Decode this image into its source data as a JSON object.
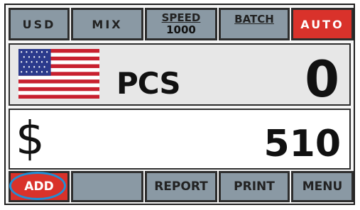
{
  "top_bar": {
    "currency": "USD",
    "mode": "MIX",
    "speed_label": "SPEED",
    "speed_value": "1000",
    "batch_label": "BATCH",
    "auto_label": "AUTO"
  },
  "pcs_panel": {
    "flag_icon": "us-flag-icon",
    "label": "PCS",
    "count": "0"
  },
  "amount_panel": {
    "symbol": "$",
    "amount": "510"
  },
  "bottom_bar": {
    "add_label": "ADD",
    "report_label": "REPORT",
    "print_label": "PRINT",
    "menu_label": "MENU"
  },
  "colors": {
    "button_gray": "#8a99a4",
    "accent_red": "#d9322b",
    "highlight_blue": "#1f8fd6"
  }
}
